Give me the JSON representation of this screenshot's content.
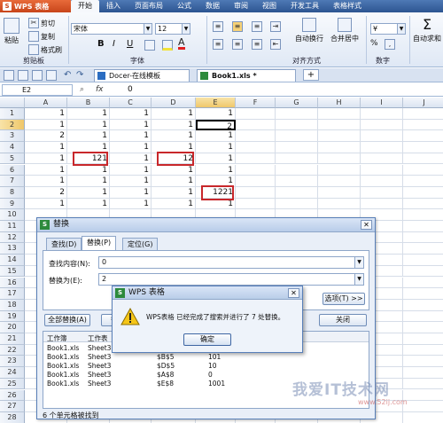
{
  "app": {
    "title": "WPS 表格",
    "logo_letter": "S"
  },
  "ribbon_tabs": [
    "开始",
    "插入",
    "页面布局",
    "公式",
    "数据",
    "审阅",
    "视图",
    "开发工具",
    "表格样式"
  ],
  "ribbon": {
    "paste": "粘贴",
    "cut": "剪切",
    "copy": "复制",
    "format_painter": "格式刷",
    "clipboard_group": "剪贴板",
    "font_name": "宋体",
    "font_size": "12",
    "bold": "B",
    "italic": "I",
    "underline": "U",
    "font_group": "字体",
    "wrap": "自动换行",
    "merge": "合并居中",
    "align_group": "对齐方式",
    "number_group": "数字",
    "percent": "%",
    "sum": "自动求和"
  },
  "doc_tabs": [
    "Docer-在线模板",
    "Book1.xls *"
  ],
  "formula_bar": {
    "cell_ref": "E2",
    "value": "0"
  },
  "columns": [
    "A",
    "B",
    "C",
    "D",
    "E",
    "F",
    "G",
    "H",
    "I",
    "J"
  ],
  "rows": [
    "1",
    "2",
    "3",
    "4",
    "5",
    "6",
    "7",
    "8",
    "9",
    "10",
    "11",
    "12",
    "13",
    "14",
    "15",
    "16",
    "17",
    "18",
    "19",
    "20",
    "21",
    "22",
    "23",
    "24",
    "25",
    "26",
    "27",
    "28"
  ],
  "cells": [
    [
      "1",
      "1",
      "1",
      "1",
      "1"
    ],
    [
      "1",
      "1",
      "1",
      "1",
      "2"
    ],
    [
      "2",
      "1",
      "1",
      "1",
      "1"
    ],
    [
      "1",
      "1",
      "1",
      "1",
      "1"
    ],
    [
      "1",
      "121",
      "1",
      "12",
      "1"
    ],
    [
      "1",
      "1",
      "1",
      "1",
      "1"
    ],
    [
      "1",
      "1",
      "1",
      "1",
      "1"
    ],
    [
      "2",
      "1",
      "1",
      "1",
      "1221"
    ],
    [
      "1",
      "1",
      "1",
      "1",
      "1"
    ]
  ],
  "replace_dialog": {
    "title": "替换",
    "tabs": [
      "查找(D)",
      "替换(P)",
      "定位(G)"
    ],
    "find_label": "查找内容(N):",
    "find_value": "0",
    "replace_label": "替换为(E):",
    "replace_value": "2",
    "options_button": "选项(T) >>",
    "replace_all_button": "全部替换(A)",
    "replace_button": "替",
    "close_button": "关闭",
    "result_headers": [
      "工作簿",
      "工作表"
    ],
    "results": [
      [
        "Book1.xls",
        "Sheet3",
        "$A$3",
        "0"
      ],
      [
        "Book1.xls",
        "Sheet3",
        "$B$5",
        "101"
      ],
      [
        "Book1.xls",
        "Sheet3",
        "$D$5",
        "10"
      ],
      [
        "Book1.xls",
        "Sheet3",
        "$A$8",
        "0"
      ],
      [
        "Book1.xls",
        "Sheet3",
        "$E$8",
        "1001"
      ]
    ],
    "status": "6 个单元格被找到"
  },
  "message_box": {
    "title": "WPS 表格",
    "text": "WPS表格 已经完成了搜索并进行了 7 处替换。",
    "ok_button": "确定"
  },
  "watermark": {
    "text": "我爱IT技术网",
    "url": "www.52ij.com"
  },
  "colors": {
    "tab_bar": "#2d5591",
    "app_button": "#c8451a",
    "highlight": "#c8272b"
  }
}
